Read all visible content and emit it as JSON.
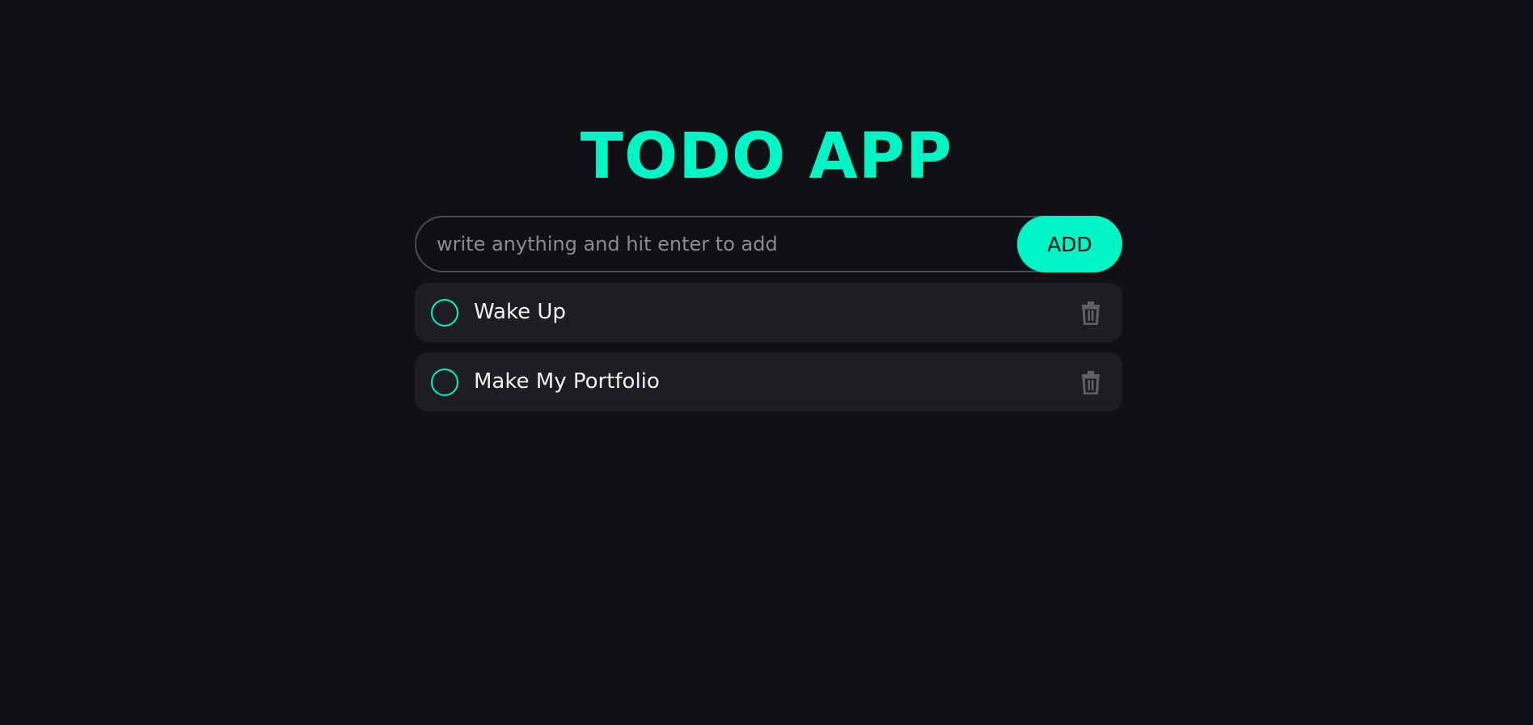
{
  "app": {
    "title": "TODO APP"
  },
  "input": {
    "placeholder": "write anything and hit enter to add",
    "value": ""
  },
  "add_button": {
    "label": "ADD"
  },
  "todos": [
    {
      "text": "Wake Up",
      "done": false
    },
    {
      "text": "Make My Portfolio",
      "done": false
    }
  ],
  "colors": {
    "background": "#101115",
    "accent": "#00f5c4",
    "card": "#1d1e22",
    "muted": "#5f6167"
  },
  "icons": {
    "check": "circle-icon",
    "delete": "trash-icon"
  }
}
